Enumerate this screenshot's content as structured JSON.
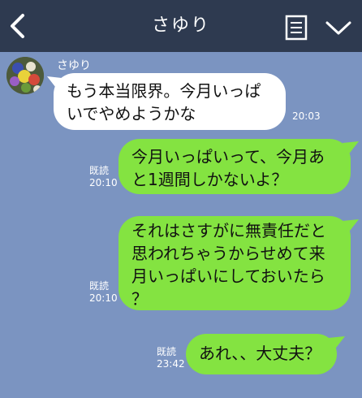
{
  "header": {
    "title": "さゆり",
    "back_icon": "chevron-left-icon",
    "notes_icon": "notes-icon",
    "menu_icon": "chevron-down-icon",
    "bg_color": "#2e3a50"
  },
  "chat": {
    "bg_color": "#7b94c1",
    "sender_name": "さゆり",
    "messages": [
      {
        "side": "received",
        "lines": [
          "もう本当限界。今月いっぱ",
          "いでやめようかな"
        ],
        "time": "20:03"
      },
      {
        "side": "sent",
        "lines": [
          "今月いっぱいって、今月あ",
          "と1週間しかないよ？"
        ],
        "read": "既読",
        "time": "20:10"
      },
      {
        "side": "sent",
        "lines": [
          "それはさすがに無責任だと",
          "思われちゃうからせめて来",
          "月いっぱいにしておいたら",
          "？"
        ],
        "read": "既読",
        "time": "20:10"
      },
      {
        "side": "sent",
        "lines": [
          "あれ、、大丈夫？"
        ],
        "read": "既読",
        "time": "23:42"
      }
    ],
    "colors": {
      "received": "#ffffff",
      "sent": "#84e341"
    }
  }
}
